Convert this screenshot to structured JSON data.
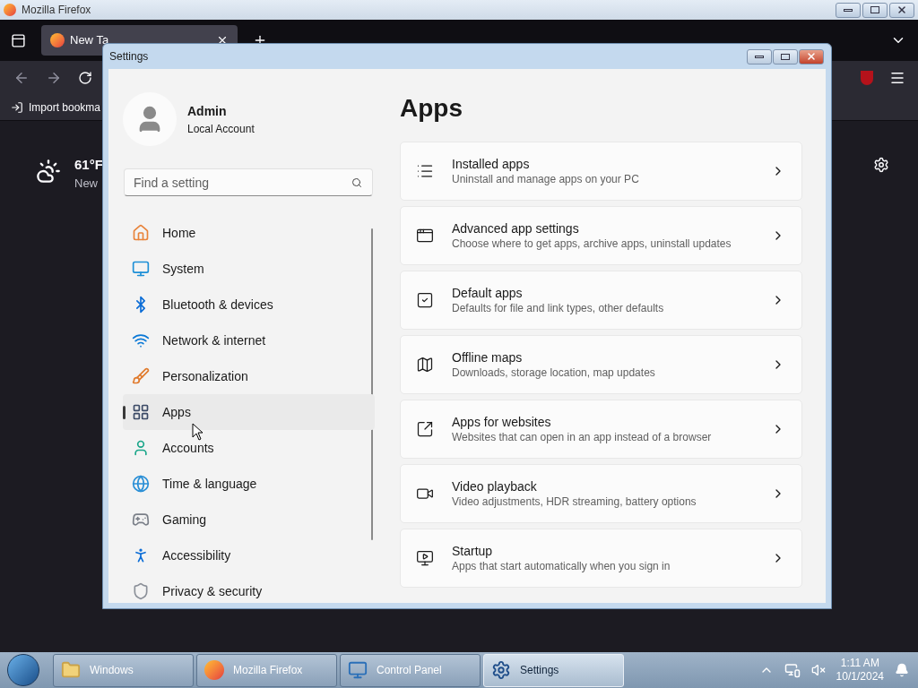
{
  "firefox": {
    "title": "Mozilla Firefox",
    "tab": {
      "label": "New Ta",
      "selected": true
    },
    "bookmark": "Import bookma",
    "weather": {
      "temperature": "61°F",
      "location": "New"
    }
  },
  "settings": {
    "title": "Settings",
    "user": {
      "name": "Admin",
      "account": "Local Account"
    },
    "search": {
      "placeholder": "Find a setting"
    },
    "nav": [
      {
        "label": "Home",
        "selected": false
      },
      {
        "label": "System",
        "selected": false
      },
      {
        "label": "Bluetooth & devices",
        "selected": false
      },
      {
        "label": "Network & internet",
        "selected": false
      },
      {
        "label": "Personalization",
        "selected": false
      },
      {
        "label": "Apps",
        "selected": true
      },
      {
        "label": "Accounts",
        "selected": false
      },
      {
        "label": "Time & language",
        "selected": false
      },
      {
        "label": "Gaming",
        "selected": false
      },
      {
        "label": "Accessibility",
        "selected": false
      },
      {
        "label": "Privacy & security",
        "selected": false
      }
    ],
    "page_title": "Apps",
    "cards": [
      {
        "title": "Installed apps",
        "subtitle": "Uninstall and manage apps on your PC"
      },
      {
        "title": "Advanced app settings",
        "subtitle": "Choose where to get apps, archive apps, uninstall updates"
      },
      {
        "title": "Default apps",
        "subtitle": "Defaults for file and link types, other defaults"
      },
      {
        "title": "Offline maps",
        "subtitle": "Downloads, storage location, map updates"
      },
      {
        "title": "Apps for websites",
        "subtitle": "Websites that can open in an app instead of a browser"
      },
      {
        "title": "Video playback",
        "subtitle": "Video adjustments, HDR streaming, battery options"
      },
      {
        "title": "Startup",
        "subtitle": "Apps that start automatically when you sign in"
      }
    ]
  },
  "taskbar": {
    "items": [
      {
        "label": "Windows",
        "selected": false
      },
      {
        "label": "Mozilla Firefox",
        "selected": false
      },
      {
        "label": "Control Panel",
        "selected": false
      },
      {
        "label": "Settings",
        "selected": true
      }
    ],
    "time": "1:11 AM",
    "date": "10/1/2024"
  }
}
